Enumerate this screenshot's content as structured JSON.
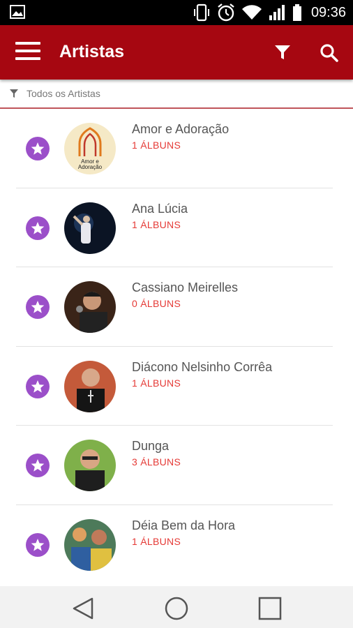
{
  "status_bar": {
    "time": "09:36"
  },
  "app_bar": {
    "title": "Artistas"
  },
  "filter": {
    "label": "Todos os Artistas"
  },
  "colors": {
    "primary": "#a60711",
    "star_badge": "#9b4fc9",
    "album_count": "#e53935"
  },
  "artists": [
    {
      "name": "Amor e Adoração",
      "albums": "1 ÁLBUNS",
      "logo_text": "Amor e Adoração"
    },
    {
      "name": "Ana Lúcia",
      "albums": "1 ÁLBUNS"
    },
    {
      "name": "Cassiano Meirelles",
      "albums": "0 ÁLBUNS"
    },
    {
      "name": "Diácono Nelsinho Corrêa",
      "albums": "1 ÁLBUNS"
    },
    {
      "name": "Dunga",
      "albums": "3 ÁLBUNS"
    },
    {
      "name": "Déia Bem da Hora",
      "albums": "1 ÁLBUNS"
    }
  ]
}
